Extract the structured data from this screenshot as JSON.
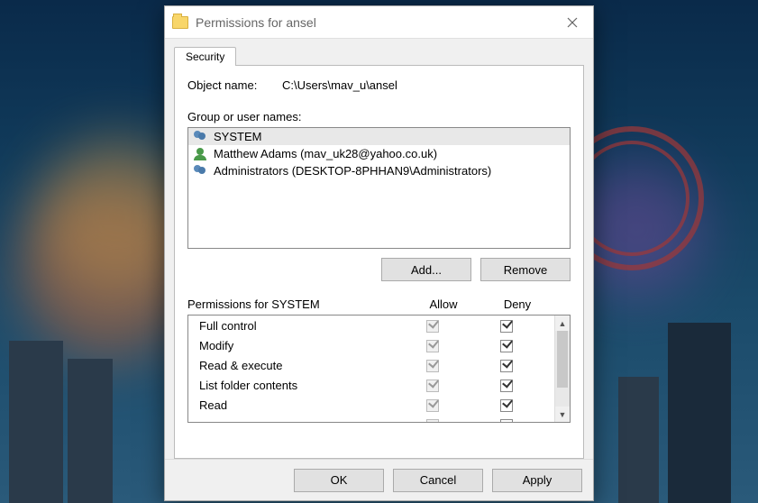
{
  "dialog": {
    "title": "Permissions for ansel",
    "object_name_label": "Object name:",
    "object_name_value": "C:\\Users\\mav_u\\ansel",
    "tab_security": "Security",
    "group_label": "Group or user names:",
    "users": [
      {
        "name": "SYSTEM",
        "type": "group",
        "selected": true
      },
      {
        "name": "Matthew Adams (mav_uk28@yahoo.co.uk)",
        "type": "user",
        "selected": false
      },
      {
        "name": "Administrators (DESKTOP-8PHHAN9\\Administrators)",
        "type": "group",
        "selected": false
      }
    ],
    "add_label": "Add...",
    "remove_label": "Remove",
    "perm_for_label": "Permissions for SYSTEM",
    "allow_label": "Allow",
    "deny_label": "Deny",
    "permissions": [
      {
        "name": "Full control",
        "allow": true,
        "allow_disabled": true,
        "deny": true
      },
      {
        "name": "Modify",
        "allow": true,
        "allow_disabled": true,
        "deny": true
      },
      {
        "name": "Read & execute",
        "allow": true,
        "allow_disabled": true,
        "deny": true
      },
      {
        "name": "List folder contents",
        "allow": true,
        "allow_disabled": true,
        "deny": true
      },
      {
        "name": "Read",
        "allow": true,
        "allow_disabled": true,
        "deny": true
      }
    ],
    "ok_label": "OK",
    "cancel_label": "Cancel",
    "apply_label": "Apply"
  }
}
